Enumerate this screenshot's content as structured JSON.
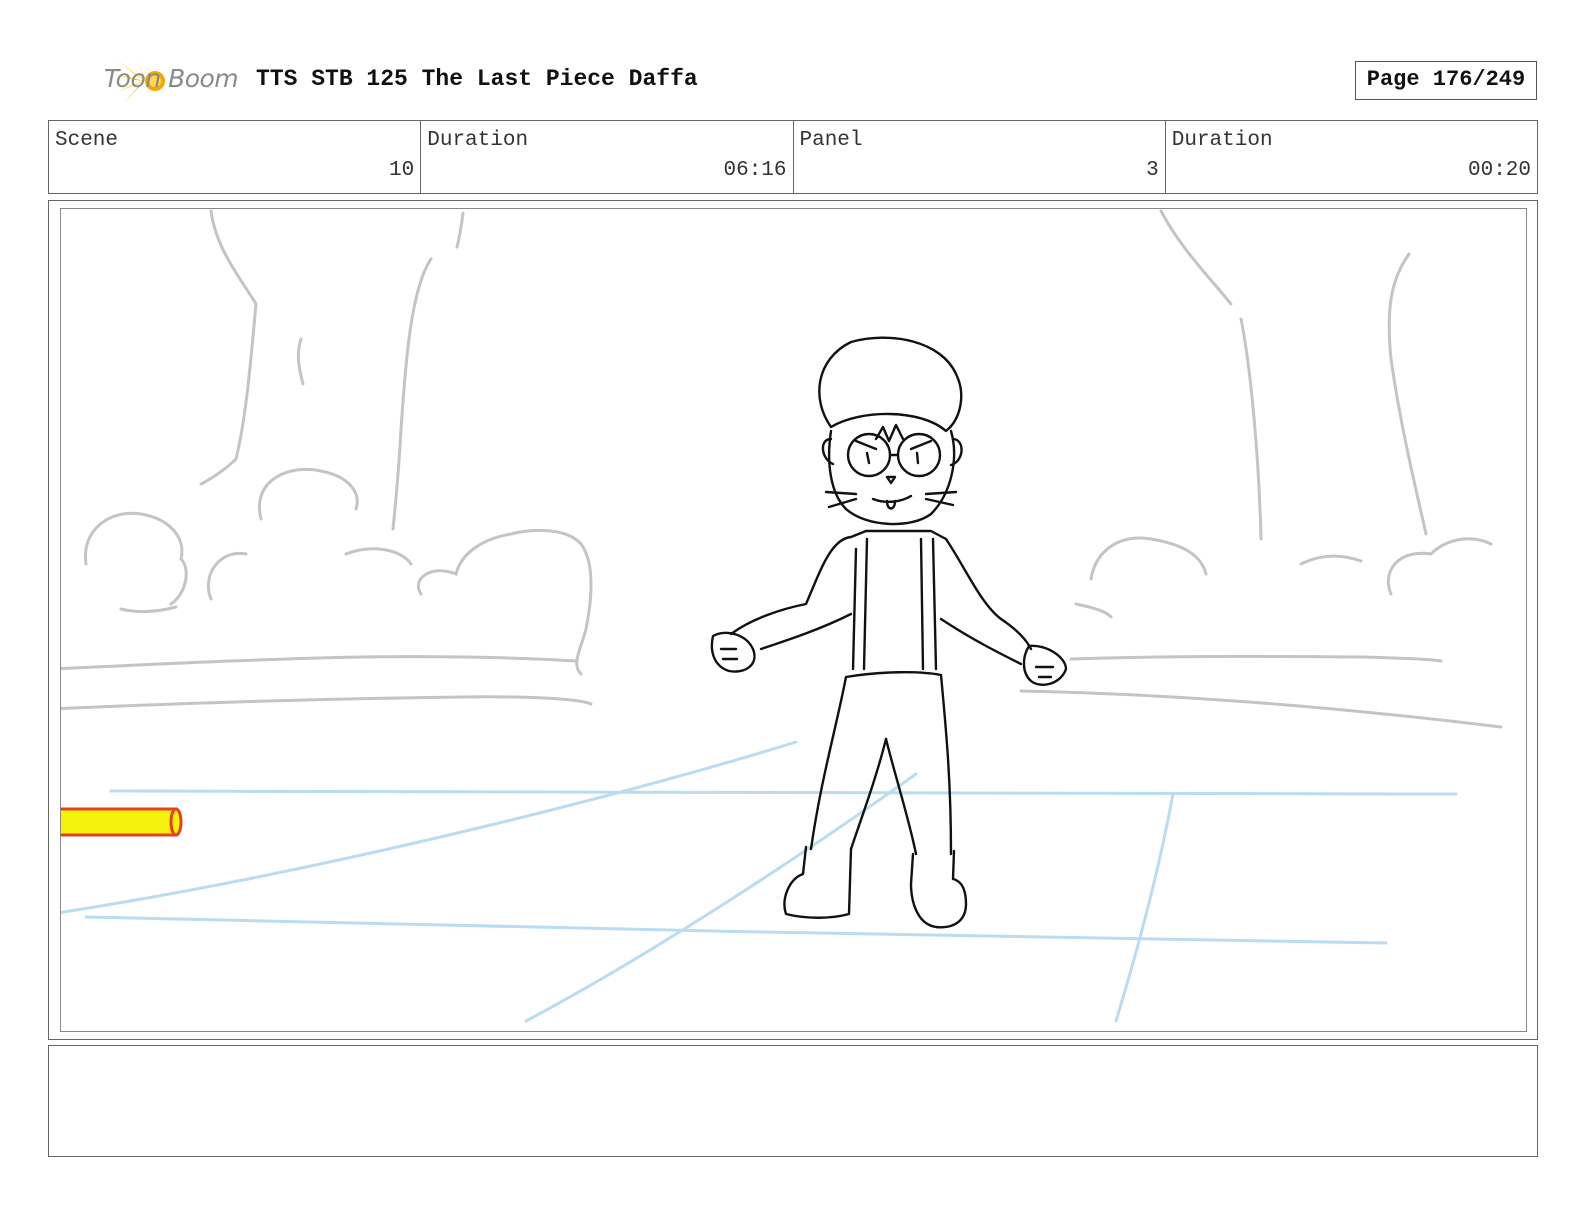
{
  "header": {
    "logo_text": "Toon Boom",
    "title": "TTS STB 125 The Last Piece Daffa",
    "page_label": "Page 176/249"
  },
  "info": [
    {
      "label": "Scene",
      "value": "10"
    },
    {
      "label": "Duration",
      "value": "06:16"
    },
    {
      "label": "Panel",
      "value": "3"
    },
    {
      "label": "Duration",
      "value": "00:20"
    }
  ],
  "colors": {
    "sketch_black": "#111111",
    "background_grey": "#c4c4c4",
    "guide_blue": "#b9dcf2",
    "prop_yellow": "#f4f20a",
    "prop_red": "#e8401c",
    "logo_yellow": "#f7c600"
  },
  "notes": ""
}
